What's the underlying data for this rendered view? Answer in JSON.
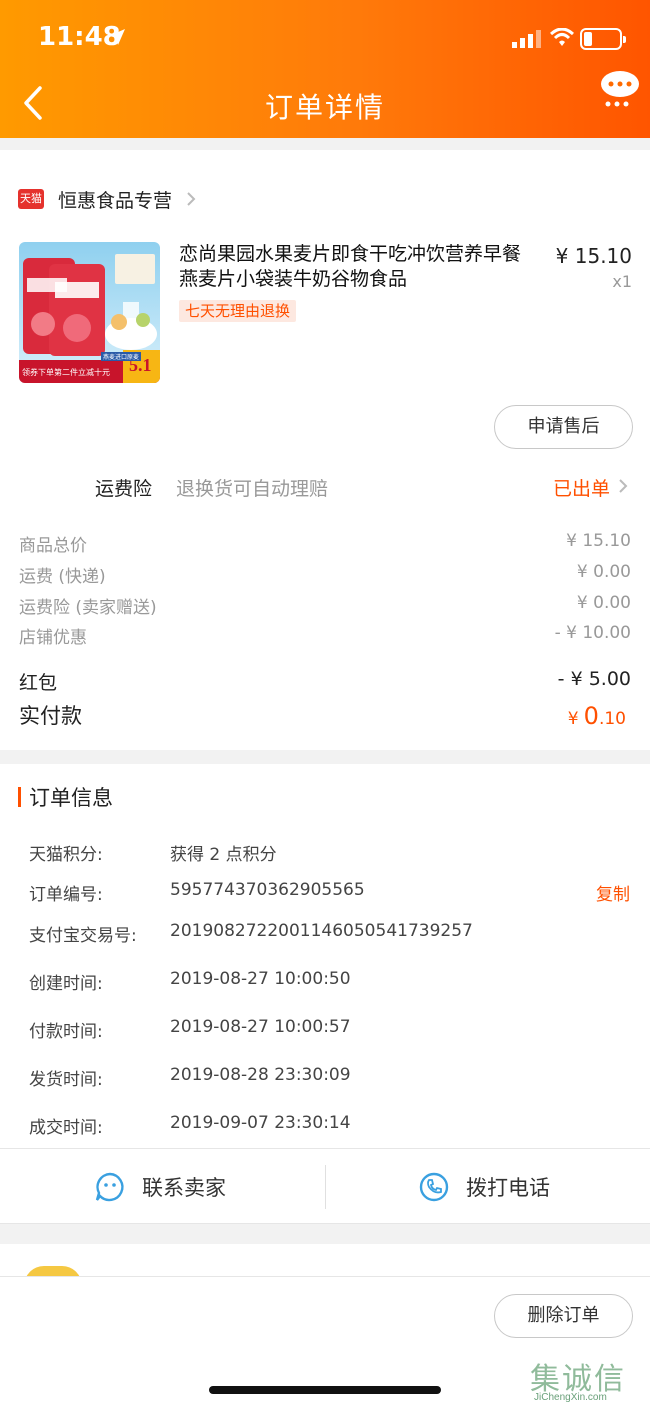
{
  "status": {
    "time": "11:48"
  },
  "nav": {
    "title": "订单详情"
  },
  "shop": {
    "badge": "天猫",
    "name": "恒惠食品专营"
  },
  "product": {
    "title": "恋尚果园水果麦片即食干吃冲饮营养早餐燕麦片小袋装牛奶谷物食品",
    "tag": "七天无理由退换",
    "price": "¥ 15.10",
    "qty": "x1",
    "image_texts": {
      "promo": "领券下单第二件立减十元",
      "badge": "5.1",
      "sticker": "燕麦进口原麦"
    }
  },
  "after_sale_label": "申请售后",
  "insurance": {
    "label": "运费险",
    "desc": "退换货可自动理赔",
    "status": "已出单"
  },
  "costs": [
    {
      "label": "商品总价",
      "value": "¥ 15.10"
    },
    {
      "label": "运费 (快递)",
      "value": "¥ 0.00"
    },
    {
      "label": "运费险 (卖家赠送)",
      "value": "¥ 0.00"
    },
    {
      "label": "店铺优惠",
      "value": "- ¥ 10.00"
    },
    {
      "label": "红包",
      "value": "- ¥ 5.00"
    }
  ],
  "paid": {
    "label": "实付款",
    "currency": "¥",
    "int": "0",
    "dec": ".10"
  },
  "order_info": {
    "title": "订单信息",
    "copy_label": "复制",
    "rows": [
      {
        "label": "天猫积分:",
        "value": "获得 2 点积分"
      },
      {
        "label": "订单编号:",
        "value": "595774370362905565"
      },
      {
        "label": "支付宝交易号:",
        "value": "2019082722001146050541739257"
      },
      {
        "label": "创建时间:",
        "value": "2019-08-27 10:00:50"
      },
      {
        "label": "付款时间:",
        "value": "2019-08-27 10:00:57"
      },
      {
        "label": "发货时间:",
        "value": "2019-08-28 23:30:09"
      },
      {
        "label": "成交时间:",
        "value": "2019-09-07 23:30:14"
      }
    ]
  },
  "contact": {
    "seller": "联系卖家",
    "phone": "拨打电话"
  },
  "delete_label": "删除订单",
  "watermark": {
    "cn": "集诚信",
    "en": "JiChengXin.com"
  },
  "colors": {
    "accent": "#ff5000",
    "header_start": "#ff9a00",
    "header_end": "#ff5500",
    "contact_icon": "#3aa0e0"
  },
  "icons": [
    "location-arrow-icon",
    "signal-icon",
    "wifi-icon",
    "battery-icon",
    "back-arrow-icon",
    "chat-bubble-icon",
    "chevron-right-icon",
    "smiley-chat-icon",
    "phone-icon"
  ]
}
